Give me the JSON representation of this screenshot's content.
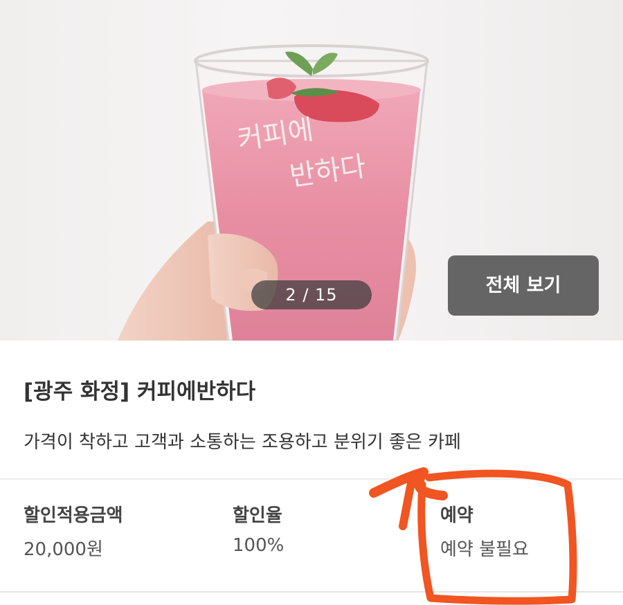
{
  "gallery": {
    "counter": "2 / 15",
    "view_all_label": "전체 보기",
    "cup_lettering": "커피에 반하다"
  },
  "store": {
    "title": "[광주 화정] 커피에반하다",
    "description": "가격이 착하고 고객과 소통하는 조용하고 분위기 좋은 카페"
  },
  "stats": [
    {
      "label": "할인적용금액",
      "value": "20,000원"
    },
    {
      "label": "할인율",
      "value": "100%"
    },
    {
      "label": "예약",
      "value": "예약 불필요"
    }
  ],
  "colors": {
    "annotation": "#f05522",
    "drink_pink": "#e88ea3"
  }
}
